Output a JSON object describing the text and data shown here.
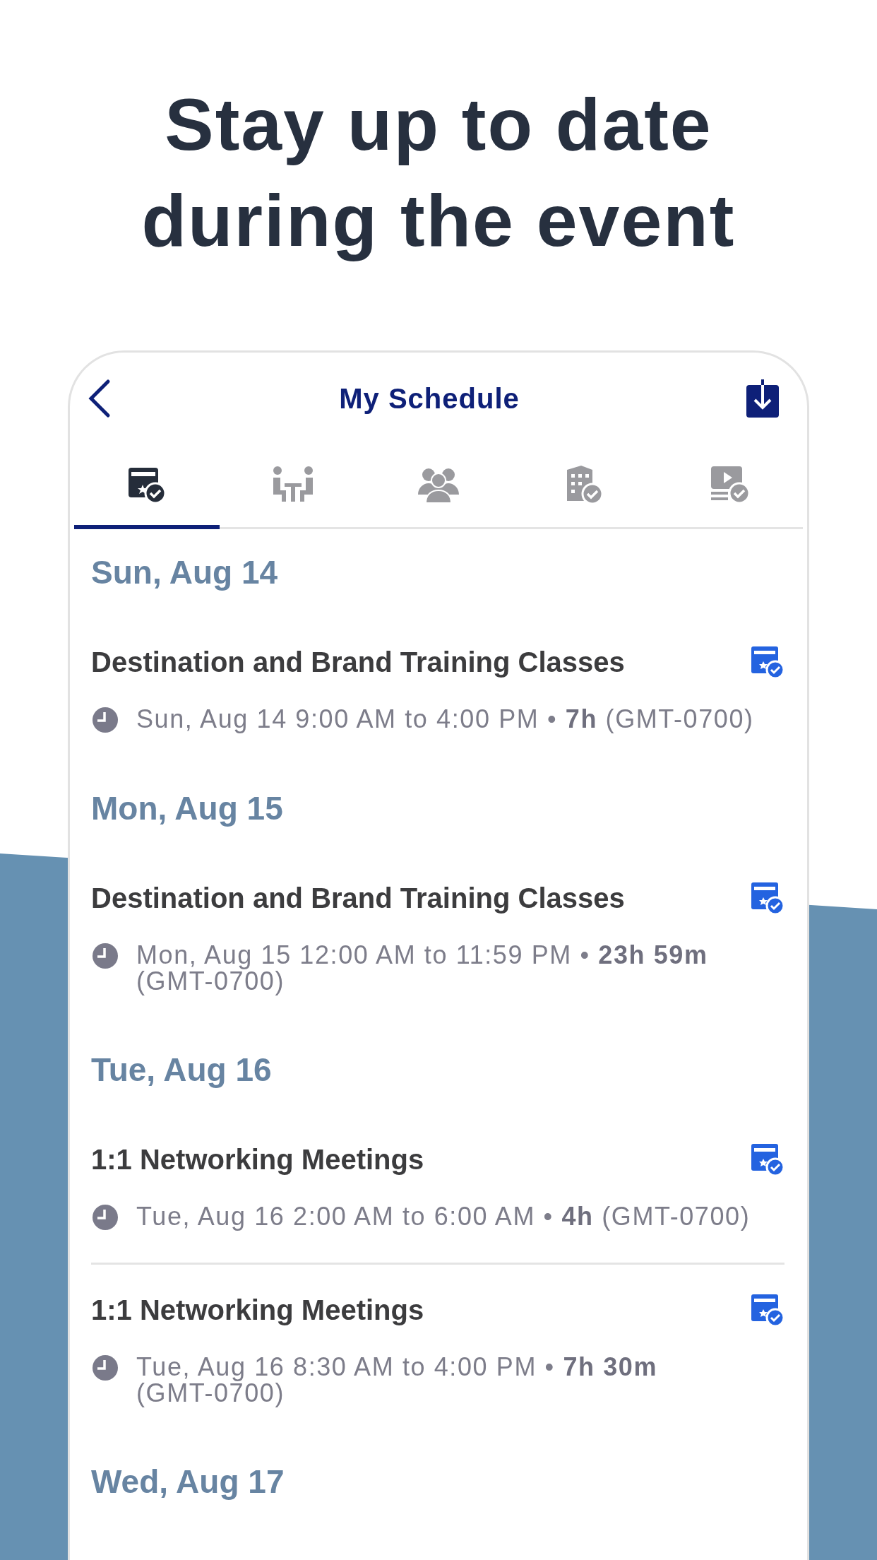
{
  "headline": "Stay up to date during the event",
  "header": {
    "title": "My Schedule"
  },
  "tabs": [
    {
      "kind": "schedule",
      "selected": true
    },
    {
      "kind": "meetings",
      "selected": false
    },
    {
      "kind": "people",
      "selected": false
    },
    {
      "kind": "venue",
      "selected": false
    },
    {
      "kind": "sessions",
      "selected": false
    }
  ],
  "sections": [
    {
      "date": "Sun, Aug 14",
      "events": [
        {
          "title": "Destination and Brand Training Classes",
          "time": "Sun, Aug 14 9:00 AM to 4:00 PM • **7h**",
          "timezone": "(GMT-0700)"
        }
      ]
    },
    {
      "date": "Mon, Aug 15",
      "events": [
        {
          "title": "Destination and Brand Training Classes",
          "time": "Mon, Aug 15 12:00 AM to 11:59 PM • **23h 59m**",
          "timezone": "(GMT-0700)"
        }
      ]
    },
    {
      "date": "Tue, Aug 16",
      "events": [
        {
          "title": "1:1 Networking Meetings",
          "time": "Tue, Aug 16 2:00 AM to 6:00 AM • **4h**",
          "timezone": "(GMT-0700)"
        },
        {
          "title": "1:1 Networking Meetings",
          "time": "Tue, Aug 16 8:30 AM to 4:00 PM • **7h 30m**",
          "timezone": "(GMT-0700)"
        }
      ]
    },
    {
      "date": "Wed, Aug 17"
    }
  ]
}
